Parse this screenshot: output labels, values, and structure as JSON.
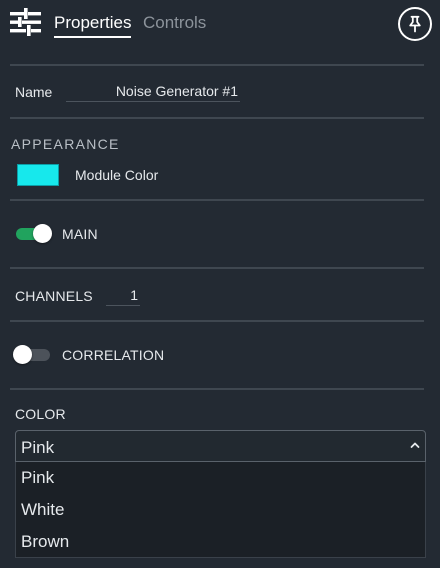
{
  "header": {
    "tabs": [
      {
        "label": "Properties",
        "active": true
      },
      {
        "label": "Controls",
        "active": false
      }
    ],
    "icons": {
      "left": "sliders-icon",
      "right": "pin-icon"
    }
  },
  "name": {
    "label": "Name",
    "value": "Noise Generator #1"
  },
  "appearance": {
    "title": "APPEARANCE",
    "module_color_label": "Module Color",
    "module_color": "#17e8ec"
  },
  "main": {
    "label": "MAIN",
    "enabled": true
  },
  "channels": {
    "label": "CHANNELS",
    "value": "1"
  },
  "correlation": {
    "label": "CORRELATION",
    "enabled": false
  },
  "color": {
    "label": "COLOR",
    "selected": "Pink",
    "options": [
      "Pink",
      "White",
      "Brown"
    ]
  },
  "theme": {
    "background": "#232a33",
    "toggle_on": "#21a35e",
    "divider": "#3f4750"
  }
}
